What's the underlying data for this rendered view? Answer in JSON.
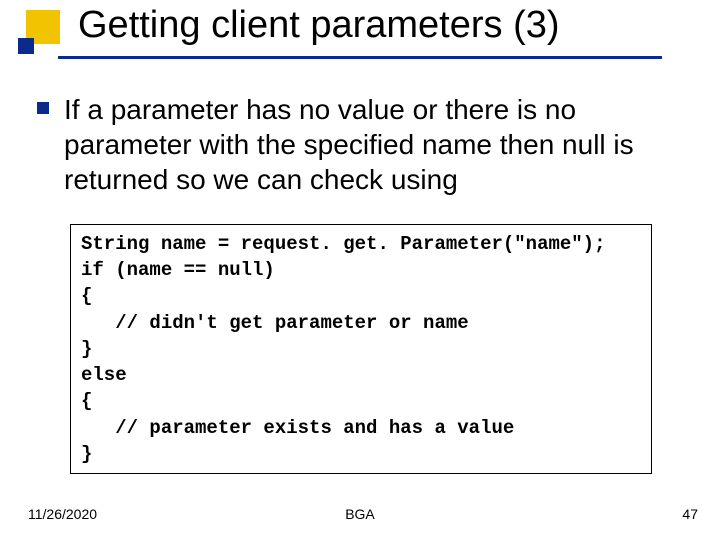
{
  "title": "Getting client parameters (3)",
  "body_text": "If a parameter has no value or there is no parameter with the specified name then null is returned so we can check using",
  "code": "String name = request. get. Parameter(\"name\");\nif (name == null)\n{\n   // didn't get parameter or name\n}\nelse\n{\n   // parameter exists and has a value\n}",
  "footer": {
    "date": "11/26/2020",
    "center": "BGA",
    "page": "47"
  }
}
